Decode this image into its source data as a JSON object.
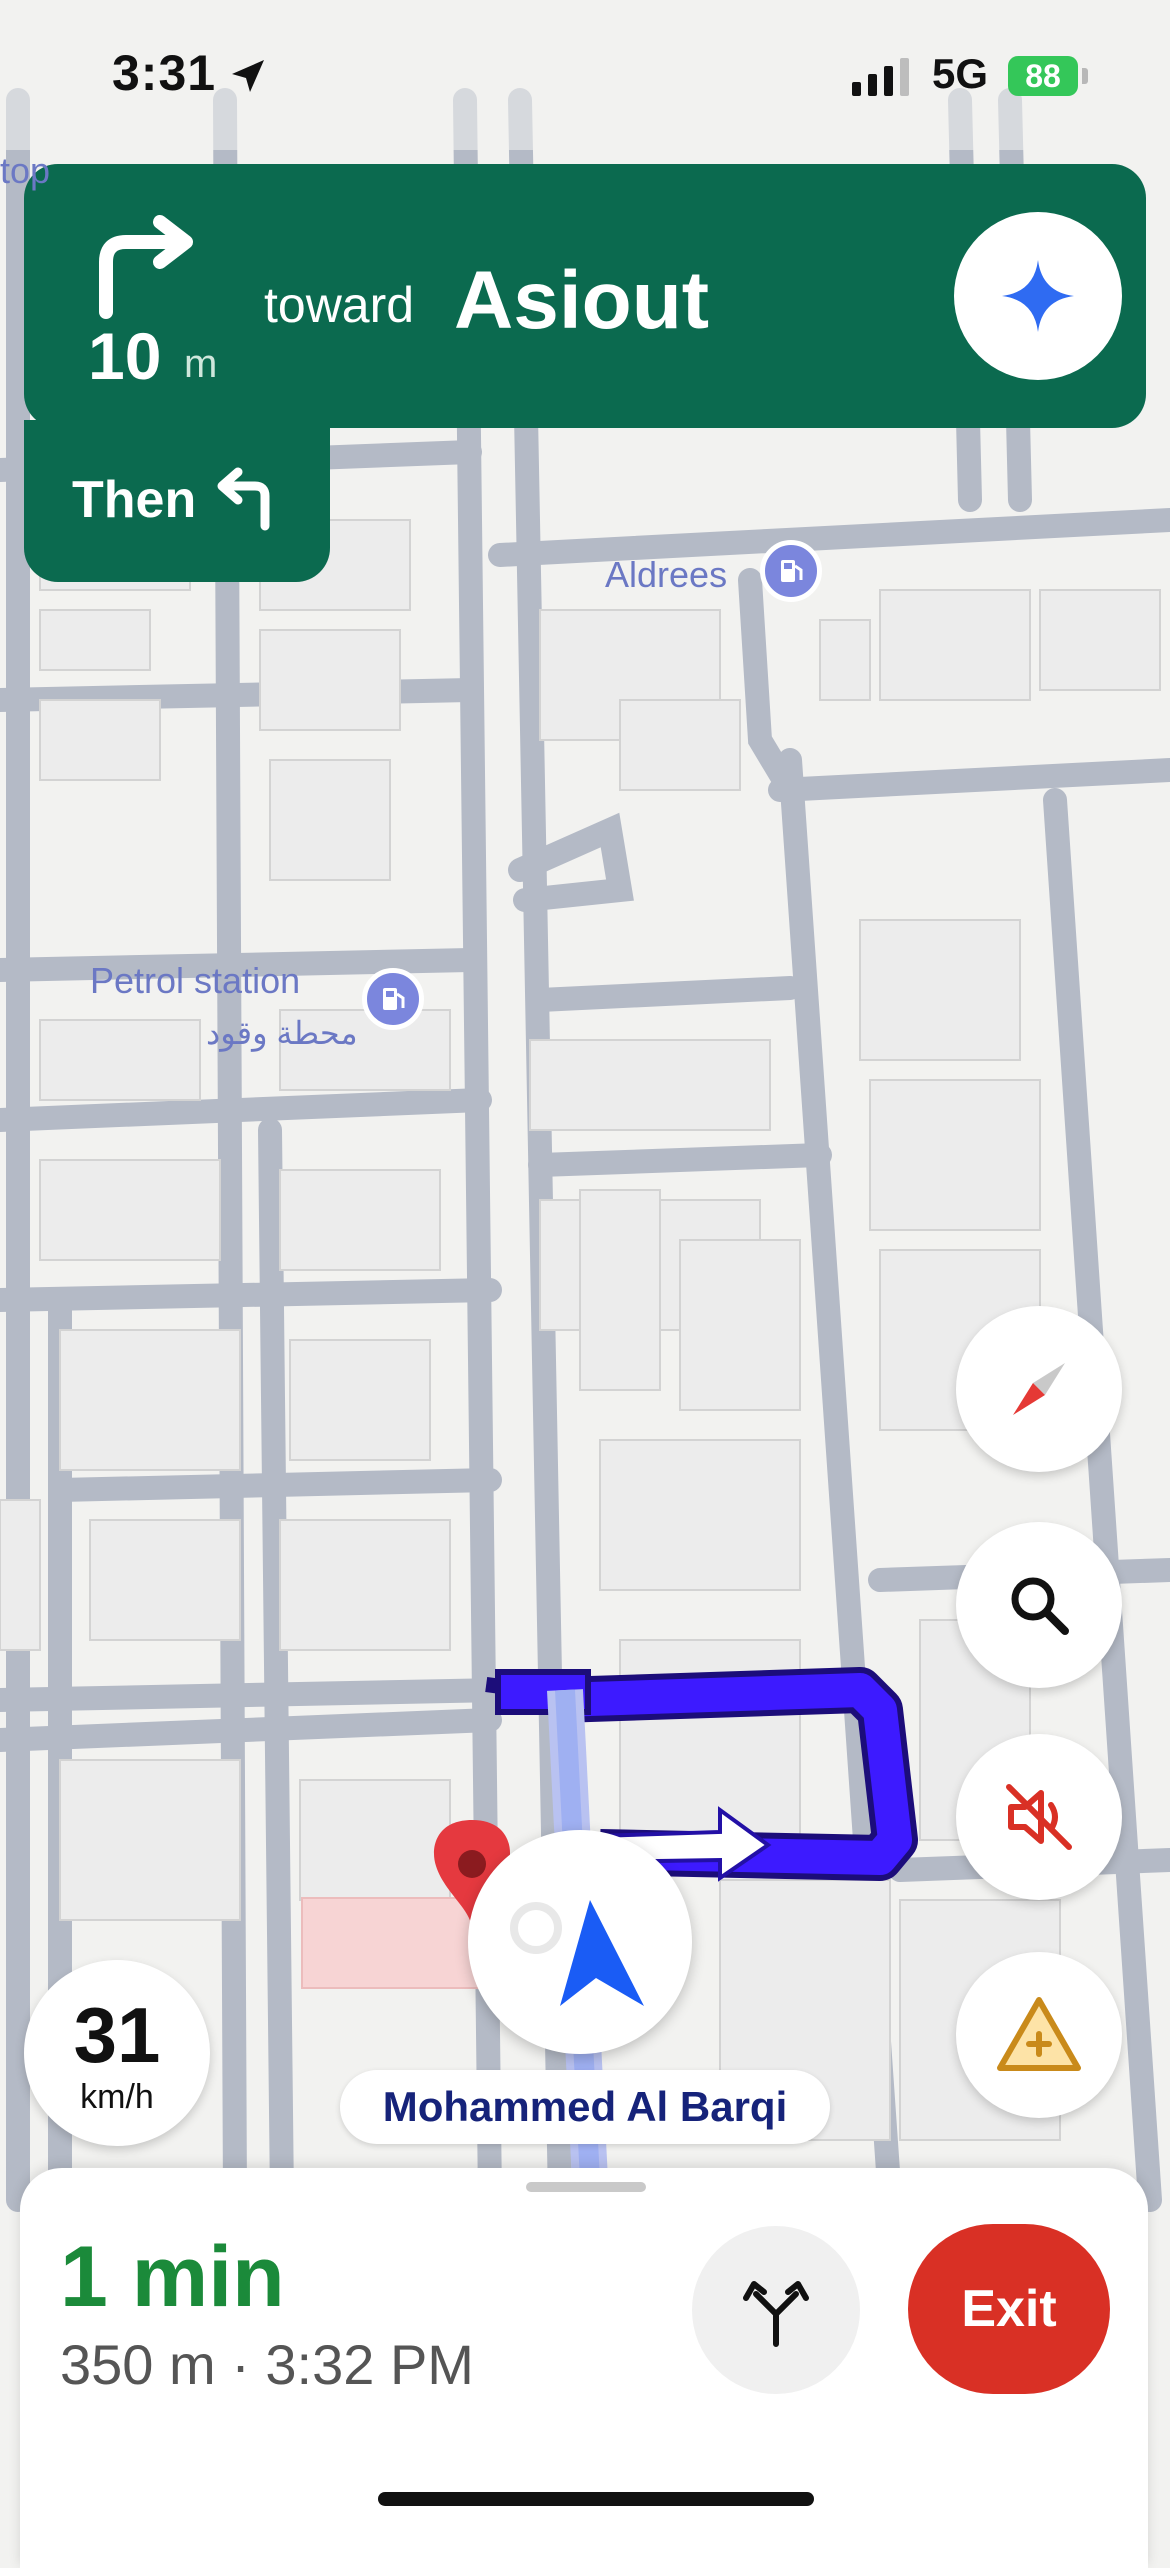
{
  "status_bar": {
    "time": "3:31",
    "network": "5G",
    "battery": "88"
  },
  "navigation": {
    "distance_value": "10",
    "distance_unit": "m",
    "toward_label": "toward",
    "street": "Asiout",
    "then_label": "Then"
  },
  "map": {
    "labels": {
      "partial_left": "top",
      "aldrees": "Aldrees",
      "petrol_station_en": "Petrol station",
      "petrol_station_ar": "محطة وقود"
    }
  },
  "speedometer": {
    "value": "31",
    "unit": "km/h"
  },
  "current_street": "Mohammed Al Barqi",
  "bottom_sheet": {
    "eta": "1 min",
    "details": "350 m · 3:32 PM",
    "exit_label": "Exit"
  },
  "colors": {
    "banner": "#0b6a4f",
    "eta_green": "#1b8a3a",
    "route": "#3d1aff",
    "exit_red": "#d93025",
    "poi": "#7b86dd"
  },
  "icons": [
    "location-arrow-icon",
    "turn-right-icon",
    "turn-left-icon",
    "gemini-sparkle-icon",
    "compass-icon",
    "search-icon",
    "sound-muted-icon",
    "report-incident-icon",
    "alternate-routes-icon",
    "navigation-arrow-icon",
    "destination-pin-icon",
    "fuel-icon"
  ]
}
